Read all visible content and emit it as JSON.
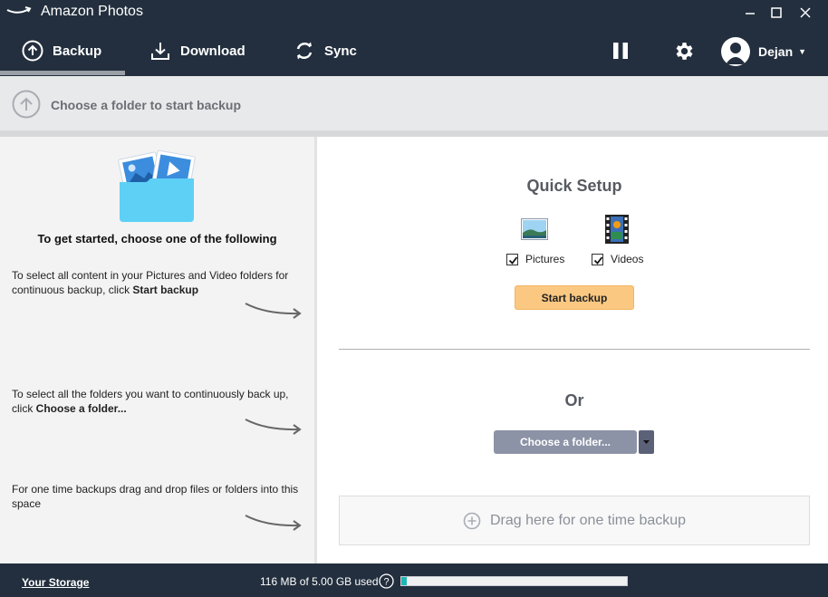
{
  "app": {
    "title": "Amazon Photos"
  },
  "nav": {
    "tabs": [
      {
        "label": "Backup",
        "active": true
      },
      {
        "label": "Download"
      },
      {
        "label": "Sync"
      }
    ],
    "user": {
      "name": "Dejan"
    }
  },
  "banner": {
    "text": "Choose a folder to start backup"
  },
  "left": {
    "heading": "To get started, choose one of the following",
    "instructions": [
      {
        "text": "To select all content in your Pictures and Video folders for continuous backup, click ",
        "bold": "Start backup"
      },
      {
        "text": "To select all the folders you want to continuously back up, click ",
        "bold": "Choose a folder..."
      },
      {
        "text": "For one time backups drag and drop files or folders into this space",
        "bold": ""
      }
    ]
  },
  "right": {
    "quick_setup_title": "Quick Setup",
    "pictures_label": "Pictures",
    "pictures_checked": true,
    "videos_label": "Videos",
    "videos_checked": true,
    "start_backup_label": "Start backup",
    "or_label": "Or",
    "choose_folder_label": "Choose a folder...",
    "dropzone_text": "Drag here for one time backup"
  },
  "footer": {
    "storage_link": "Your Storage",
    "storage_used": "116 MB of 5.00 GB used",
    "storage_fraction": 0.023
  },
  "colors": {
    "topbar": "#232f3e",
    "start_backup": "#fbc882",
    "choose_folder": "#8c93a6",
    "storage_fill": "#1fb7b6"
  },
  "icons": {
    "logo": "amazon-smile-icon",
    "backup": "upload-circle-icon",
    "download": "download-icon",
    "sync": "sync-icon",
    "pause": "pause-icon",
    "settings": "gear-icon",
    "dropdown": "caret-down-icon"
  }
}
